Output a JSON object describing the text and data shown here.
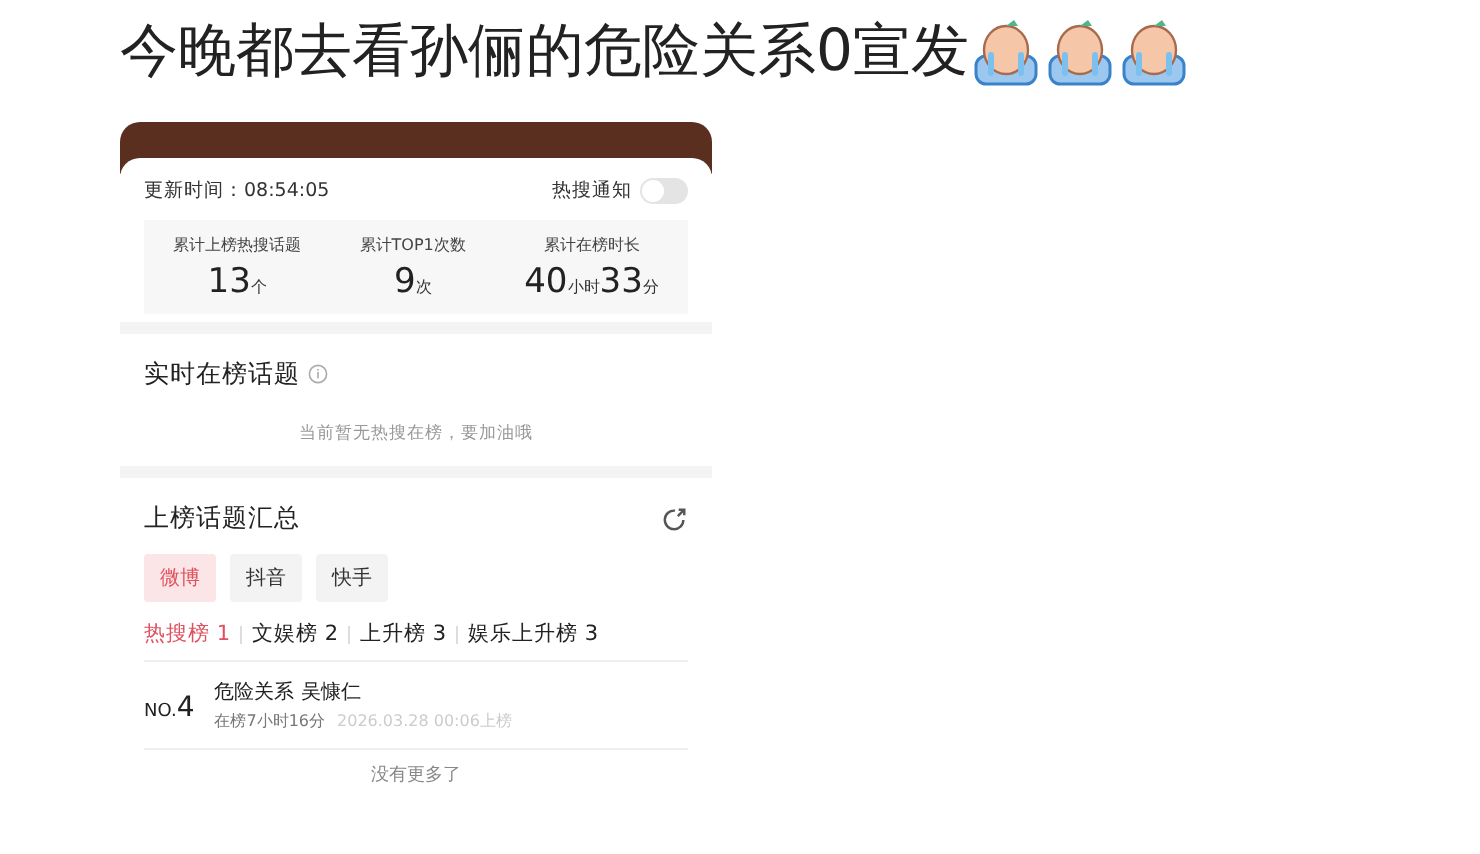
{
  "post": {
    "text": "今晚都去看孙俪的危险关系0宣发",
    "emojis": [
      {
        "kind": "crying"
      },
      {
        "kind": "crying"
      },
      {
        "kind": "crying"
      }
    ]
  },
  "card": {
    "update_time": "更新时间：08:54:05",
    "notify": {
      "label": "热搜通知",
      "on": false
    },
    "stats": [
      {
        "label": "累计上榜热搜话题",
        "parts": [
          {
            "num": "13",
            "unit": "个"
          }
        ]
      },
      {
        "label": "累计TOP1次数",
        "parts": [
          {
            "num": "9",
            "unit": "次"
          }
        ]
      },
      {
        "label": "累计在榜时长",
        "parts": [
          {
            "num": "40",
            "unit": "小时"
          },
          {
            "num": "33",
            "unit": "分"
          }
        ]
      }
    ],
    "realtime": {
      "title": "实时在榜话题",
      "empty": "当前暂无热搜在榜，要加油哦"
    },
    "summary": {
      "title": "上榜话题汇总",
      "platforms": [
        {
          "label": "微博",
          "selected": true
        },
        {
          "label": "抖音",
          "selected": false
        },
        {
          "label": "快手",
          "selected": false
        }
      ],
      "boards": [
        {
          "label": "热搜榜 1",
          "selected": true
        },
        {
          "label": "文娱榜 2",
          "selected": false
        },
        {
          "label": "上升榜 3",
          "selected": false
        },
        {
          "label": "娱乐上升榜 3",
          "selected": false
        }
      ],
      "rows": [
        {
          "rank_prefix": "NO.",
          "rank": "4",
          "title": "危险关系 吴慷仁",
          "duration": "在榜7小时16分",
          "date": "2026.03.28 00:06上榜"
        }
      ],
      "footer": "没有更多了"
    }
  }
}
